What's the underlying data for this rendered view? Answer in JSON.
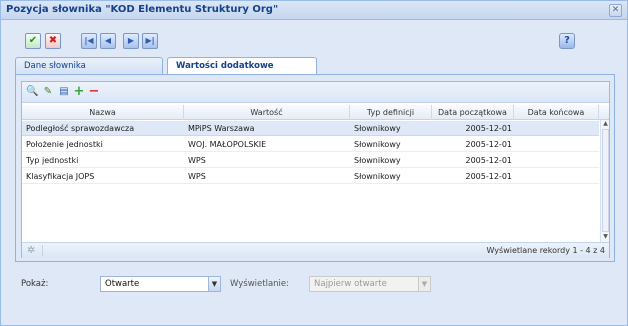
{
  "window": {
    "title": "Pozycja słownika \"KOD Elementu Struktury Org\"",
    "close_glyph": "✕"
  },
  "toolbar": {
    "ok_icon": "check-icon",
    "cancel_icon": "x-icon",
    "first_icon": "first-icon",
    "prev_icon": "prev-icon",
    "next_icon": "next-icon",
    "last_icon": "last-icon",
    "help_icon": "help-icon"
  },
  "tabs": [
    {
      "label": "Dane słownika",
      "active": false
    },
    {
      "label": "Wartości dodatkowe",
      "active": true
    }
  ],
  "grid": {
    "columns": [
      "Nazwa",
      "Wartość",
      "Typ definicji",
      "Data początkowa",
      "Data końcowa"
    ],
    "rows": [
      {
        "nazwa": "Podległość sprawozdawcza",
        "wartosc": "MPiPS Warszawa",
        "typ": "Słownikowy",
        "data_pocz": "2005-12-01",
        "data_konc": "",
        "selected": true
      },
      {
        "nazwa": "Położenie jednostki",
        "wartosc": "WOJ. MAŁOPOLSKIE",
        "typ": "Słownikowy",
        "data_pocz": "2005-12-01",
        "data_konc": "",
        "selected": false
      },
      {
        "nazwa": "Typ jednostki",
        "wartosc": "WPS",
        "typ": "Słownikowy",
        "data_pocz": "2005-12-01",
        "data_konc": "",
        "selected": false
      },
      {
        "nazwa": "Klasyfikacja JOPS",
        "wartosc": "WPS",
        "typ": "Słownikowy",
        "data_pocz": "2005-12-01",
        "data_konc": "",
        "selected": false
      }
    ],
    "status": "Wyświetlane rekordy 1 - 4 z 4"
  },
  "filters": {
    "pokaz_label": "Pokaż:",
    "pokaz_value": "Otwarte",
    "wyswietlanie_label": "Wyświetlanie:",
    "wyswietlanie_value": "Najpierw otwarte"
  },
  "colors": {
    "accent": "#15428b",
    "border": "#99bbe8",
    "panel_bg": "#dfe8f6",
    "selected_row": "#dfe8f6"
  }
}
